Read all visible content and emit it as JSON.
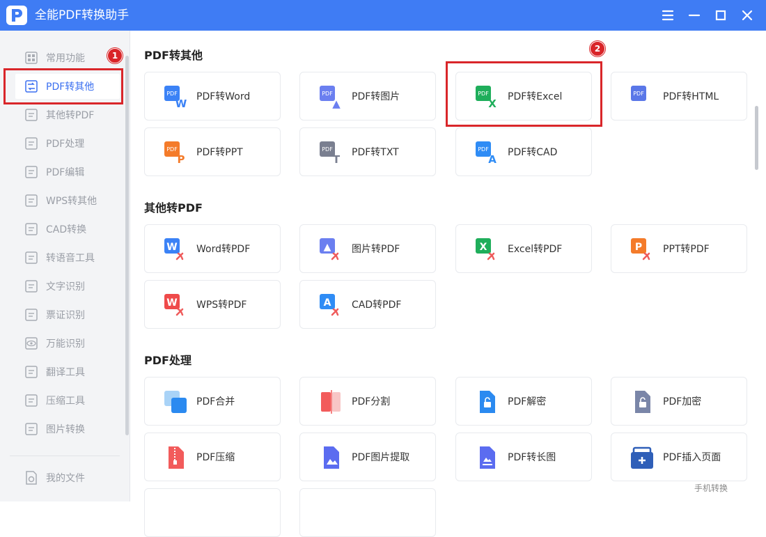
{
  "app": {
    "title": "全能PDF转换助手"
  },
  "sidebar": {
    "items": [
      {
        "label": "常用功能",
        "icon": "grid-icon"
      },
      {
        "label": "PDF转其他",
        "icon": "pdf-convert-icon"
      },
      {
        "label": "其他转PDF",
        "icon": "to-pdf-icon"
      },
      {
        "label": "PDF处理",
        "icon": "pdf-process-icon"
      },
      {
        "label": "PDF编辑",
        "icon": "pdf-edit-icon"
      },
      {
        "label": "WPS转其他",
        "icon": "wps-icon"
      },
      {
        "label": "CAD转换",
        "icon": "cad-icon"
      },
      {
        "label": "转语音工具",
        "icon": "voice-icon"
      },
      {
        "label": "文字识别",
        "icon": "text-ocr-icon"
      },
      {
        "label": "票证识别",
        "icon": "ticket-ocr-icon"
      },
      {
        "label": "万能识别",
        "icon": "eye-icon"
      },
      {
        "label": "翻译工具",
        "icon": "translate-icon"
      },
      {
        "label": "压缩工具",
        "icon": "zip-icon"
      },
      {
        "label": "图片转换",
        "icon": "image-convert-icon"
      }
    ],
    "active_index": 1,
    "footer_label": "我的文件"
  },
  "annotations": {
    "marker1": "1",
    "marker2": "2"
  },
  "sections": [
    {
      "title": "PDF转其他",
      "cards": [
        {
          "label": "PDF转Word"
        },
        {
          "label": "PDF转图片"
        },
        {
          "label": "PDF转Excel"
        },
        {
          "label": "PDF转HTML"
        },
        {
          "label": "PDF转PPT"
        },
        {
          "label": "PDF转TXT"
        },
        {
          "label": "PDF转CAD"
        }
      ]
    },
    {
      "title": "其他转PDF",
      "cards": [
        {
          "label": "Word转PDF"
        },
        {
          "label": "图片转PDF"
        },
        {
          "label": "Excel转PDF"
        },
        {
          "label": "PPT转PDF"
        },
        {
          "label": "WPS转PDF"
        },
        {
          "label": "CAD转PDF"
        }
      ]
    },
    {
      "title": "PDF处理",
      "cards": [
        {
          "label": "PDF合并"
        },
        {
          "label": "PDF分割"
        },
        {
          "label": "PDF解密"
        },
        {
          "label": "PDF加密"
        },
        {
          "label": "PDF压缩"
        },
        {
          "label": "PDF图片提取"
        },
        {
          "label": "PDF转长图"
        },
        {
          "label": "PDF插入页面"
        }
      ]
    }
  ],
  "icon_texts": {
    "pdf": "PDF",
    "word": "W",
    "txt": "T",
    "ppt": "P",
    "cad": "A",
    "excel": "X"
  },
  "floating_link": "手机转换",
  "colors": {
    "brand": "#3f7cf4",
    "highlight": "#d9262a",
    "word": "#3b82f6",
    "excel": "#1fae5b",
    "ppt": "#f47b2a",
    "cad": "#2f8cf5",
    "wps": "#ef4a4a"
  }
}
